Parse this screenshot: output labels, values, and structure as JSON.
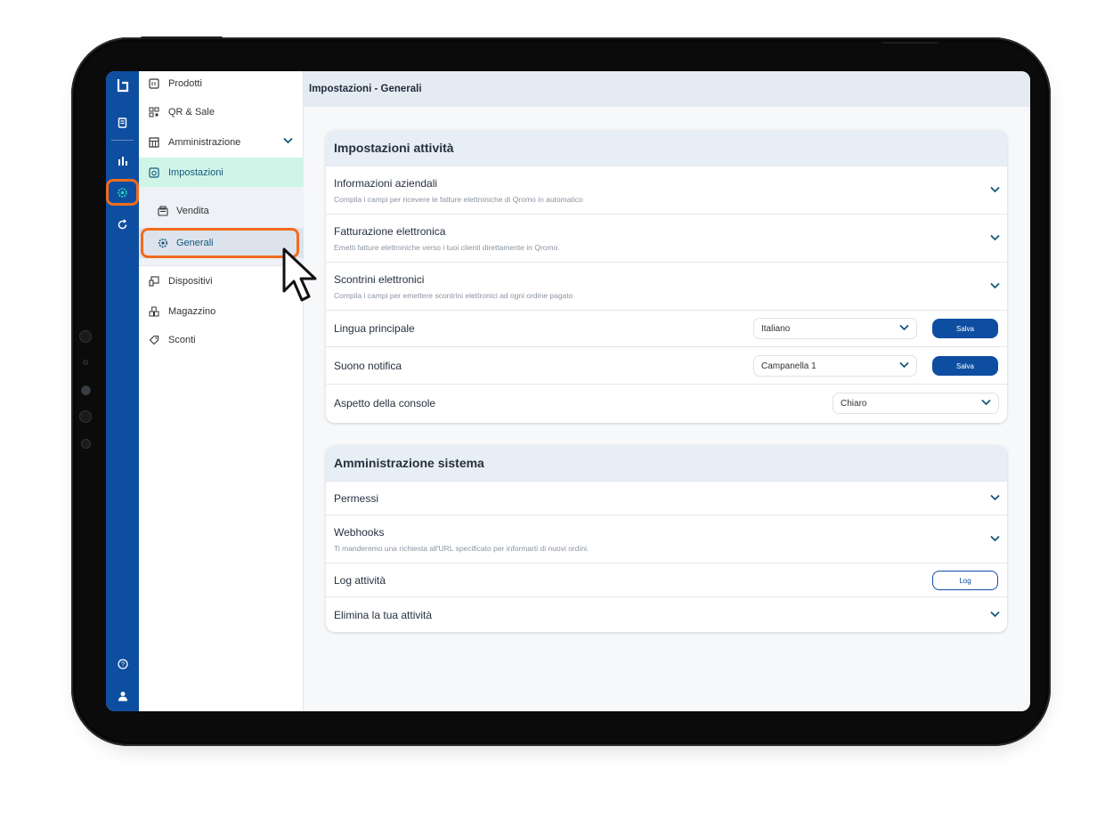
{
  "colors": {
    "brand_blue": "#0e4ea0",
    "accent_teal": "#27d8b5",
    "active_bg": "#cff5e9",
    "highlight_orange": "#f26b1d"
  },
  "rail": {
    "icons": [
      "logo-icon",
      "receipt-icon",
      "chart-icon",
      "gear-icon",
      "refresh-icon",
      "help-icon",
      "user-icon"
    ]
  },
  "nav": {
    "items": [
      {
        "label": "Prodotti",
        "icon": "menu-book-icon"
      },
      {
        "label": "QR & Sale",
        "icon": "qr-icon"
      },
      {
        "label": "Amministrazione",
        "icon": "calculator-icon"
      },
      {
        "label": "Impostazioni",
        "icon": "settings-box-icon"
      },
      {
        "label": "Dispositivi",
        "icon": "devices-icon"
      },
      {
        "label": "Magazzino",
        "icon": "warehouse-icon"
      },
      {
        "label": "Sconti",
        "icon": "tag-icon"
      }
    ],
    "sub_items": [
      {
        "label": "Vendita",
        "icon": "register-icon"
      },
      {
        "label": "Generali",
        "icon": "gear-icon"
      }
    ]
  },
  "header": {
    "title": "Impostazioni - Generali"
  },
  "business_settings": {
    "title": "Impostazioni attività",
    "rows": [
      {
        "title": "Informazioni aziendali",
        "subtitle": "Compila i campi per ricevere le fatture elettroniche di Qromo in automatico"
      },
      {
        "title": "Fatturazione elettronica",
        "subtitle": "Emetti fatture elettroniche verso i tuoi clienti direttamente in Qromo."
      },
      {
        "title": "Scontrini elettronici",
        "subtitle": "Compila i campi per emettere scontrini elettronici ad ogni ordine pagato"
      }
    ],
    "language": {
      "label": "Lingua principale",
      "value": "Italiano",
      "button": "Salva"
    },
    "sound": {
      "label": "Suono notifica",
      "value": "Campanella 1",
      "button": "Salva"
    },
    "appearance": {
      "label": "Aspetto della console",
      "value": "Chiaro"
    }
  },
  "system_admin": {
    "title": "Amministrazione sistema",
    "permissions": {
      "title": "Permessi"
    },
    "webhooks": {
      "title": "Webhooks",
      "subtitle": "Ti manderemo una richiesta all'URL specificato per informarti di nuovi ordini."
    },
    "activity_log": {
      "title": "Log attività",
      "button": "Log"
    },
    "delete": {
      "title": "Elimina la tua attività"
    }
  }
}
